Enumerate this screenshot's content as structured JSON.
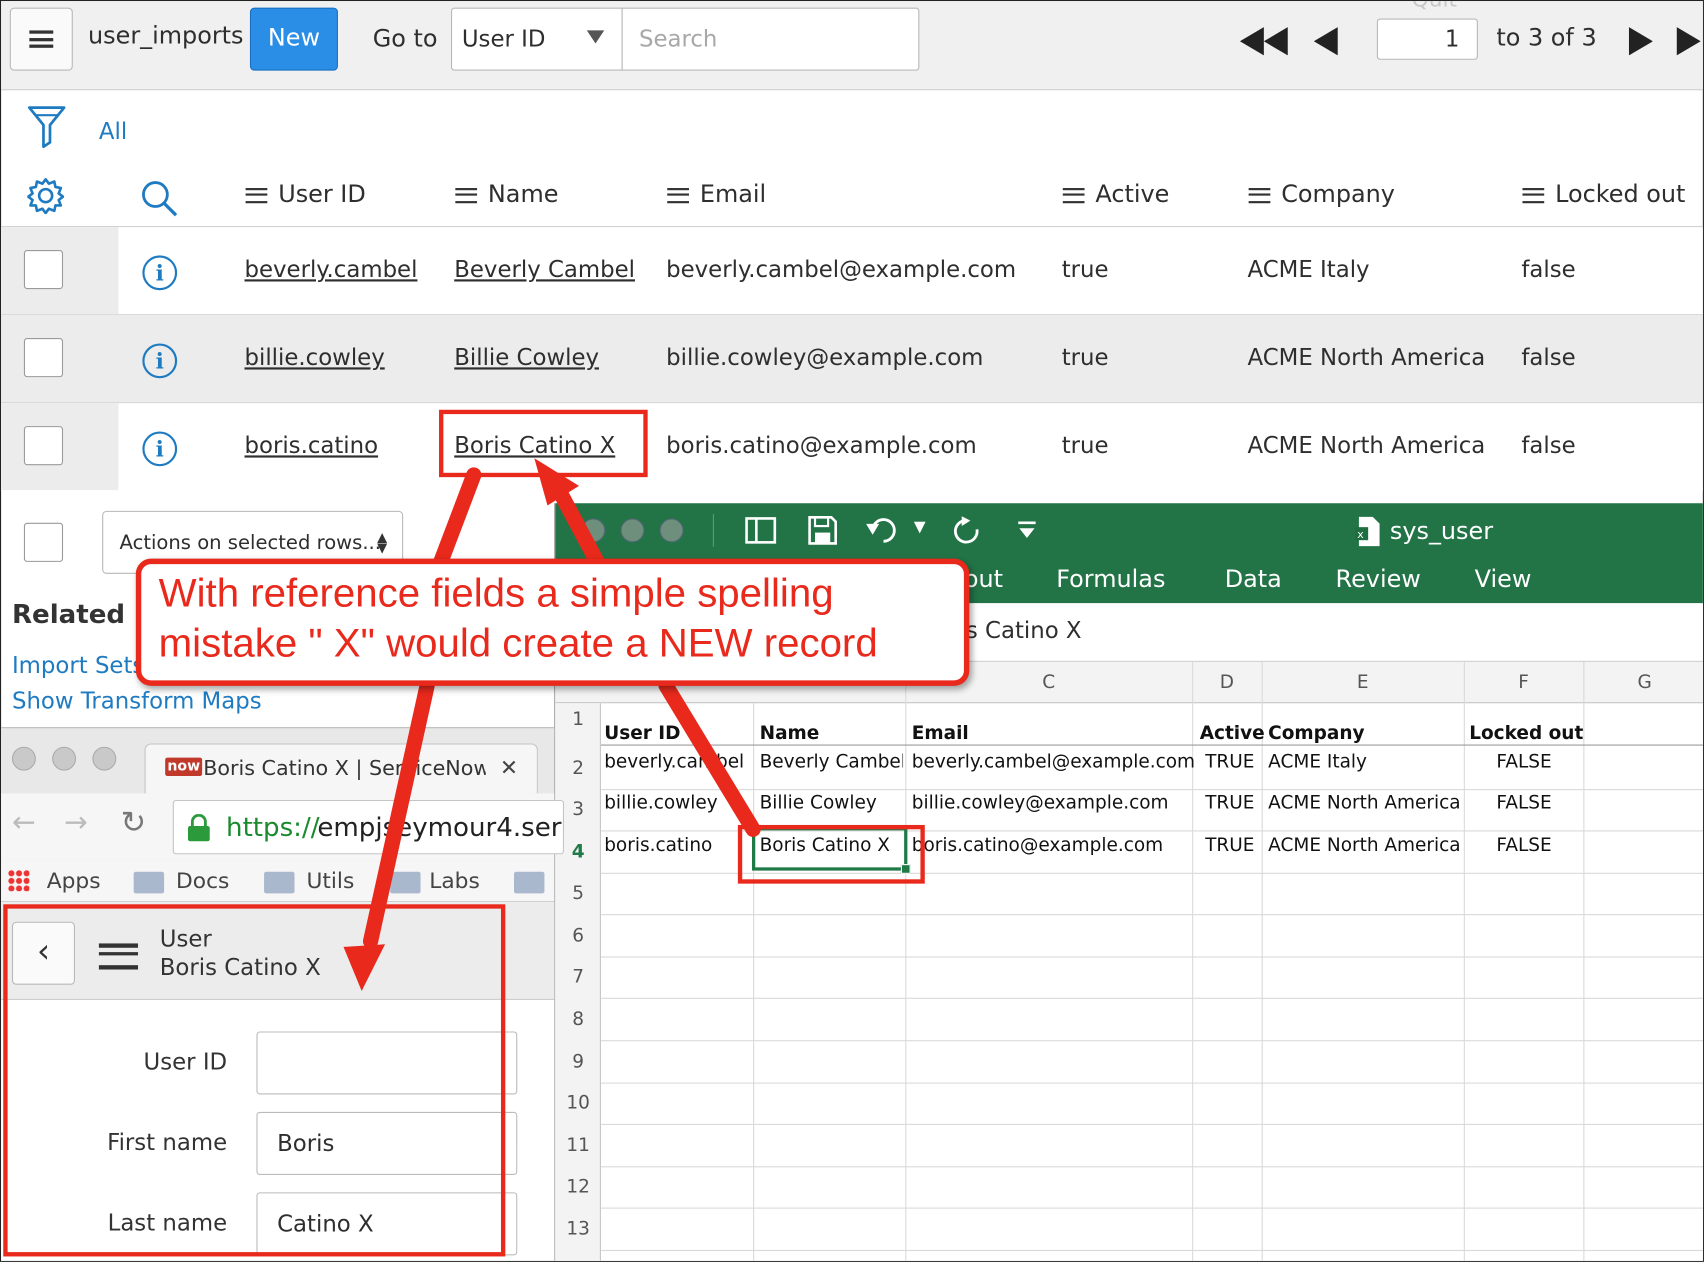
{
  "toolbar": {
    "table_name": "user_imports",
    "new_label": "New",
    "goto_label": "Go to",
    "field_select": "User ID",
    "search_placeholder": "Search",
    "page_value": "1",
    "page_range": "to 3 of 3",
    "partial_quit": "Quit"
  },
  "filter": {
    "all_label": "All"
  },
  "columns": [
    "User ID",
    "Name",
    "Email",
    "Active",
    "Company",
    "Locked out"
  ],
  "rows": [
    {
      "user_id": "beverly.cambel",
      "name": "Beverly Cambel",
      "email": "beverly.cambel@example.com",
      "active": "true",
      "company": "ACME Italy",
      "locked": "false"
    },
    {
      "user_id": "billie.cowley",
      "name": "Billie Cowley",
      "email": "billie.cowley@example.com",
      "active": "true",
      "company": "ACME North America",
      "locked": "false"
    },
    {
      "user_id": "boris.catino",
      "name": "Boris Catino X",
      "email": "boris.catino@example.com",
      "active": "true",
      "company": "ACME North America",
      "locked": "false"
    }
  ],
  "actions_label": "Actions on selected rows...",
  "related": {
    "title": "Related L",
    "link1": "Import Sets",
    "link2": "Show Transform Maps"
  },
  "callout": {
    "line1": "With reference fields a simple spelling",
    "line2": "mistake \" X\" would create a NEW record"
  },
  "excel": {
    "file_title": "sys_user",
    "ribbon_partial": "out",
    "ribbon_tabs": [
      "Formulas",
      "Data",
      "Review",
      "View"
    ],
    "formula_value": "is Catino X",
    "col_letters": [
      "C",
      "D",
      "E",
      "F",
      "G"
    ],
    "header_row": [
      "User ID",
      "Name",
      "Email",
      "Active",
      "Company",
      "Locked out"
    ],
    "data_rows": [
      [
        "beverly.cambel",
        "Beverly Cambel",
        "beverly.cambel@example.com",
        "TRUE",
        "ACME Italy",
        "FALSE"
      ],
      [
        "billie.cowley",
        "Billie Cowley",
        "billie.cowley@example.com",
        "TRUE",
        "ACME North America",
        "FALSE"
      ],
      [
        "boris.catino",
        "Boris Catino X",
        "boris.catino@example.com",
        "TRUE",
        "ACME North America",
        "FALSE"
      ]
    ],
    "row_numbers": [
      "1",
      "2",
      "3",
      "4",
      "5",
      "6",
      "7",
      "8",
      "9",
      "10",
      "11",
      "12",
      "13"
    ]
  },
  "browser": {
    "tab_logo": "now",
    "tab_title": "Boris Catino X | ServiceNow",
    "url_scheme": "https://",
    "url_rest": "empjseymour4.ser",
    "bookmarks": [
      "Apps",
      "Docs",
      "Utils",
      "Labs"
    ]
  },
  "form": {
    "header_label": "User",
    "header_name": "Boris Catino X",
    "fields": [
      {
        "label": "User ID",
        "value": ""
      },
      {
        "label": "First name",
        "value": "Boris"
      },
      {
        "label": "Last name",
        "value": "Catino X"
      }
    ]
  }
}
